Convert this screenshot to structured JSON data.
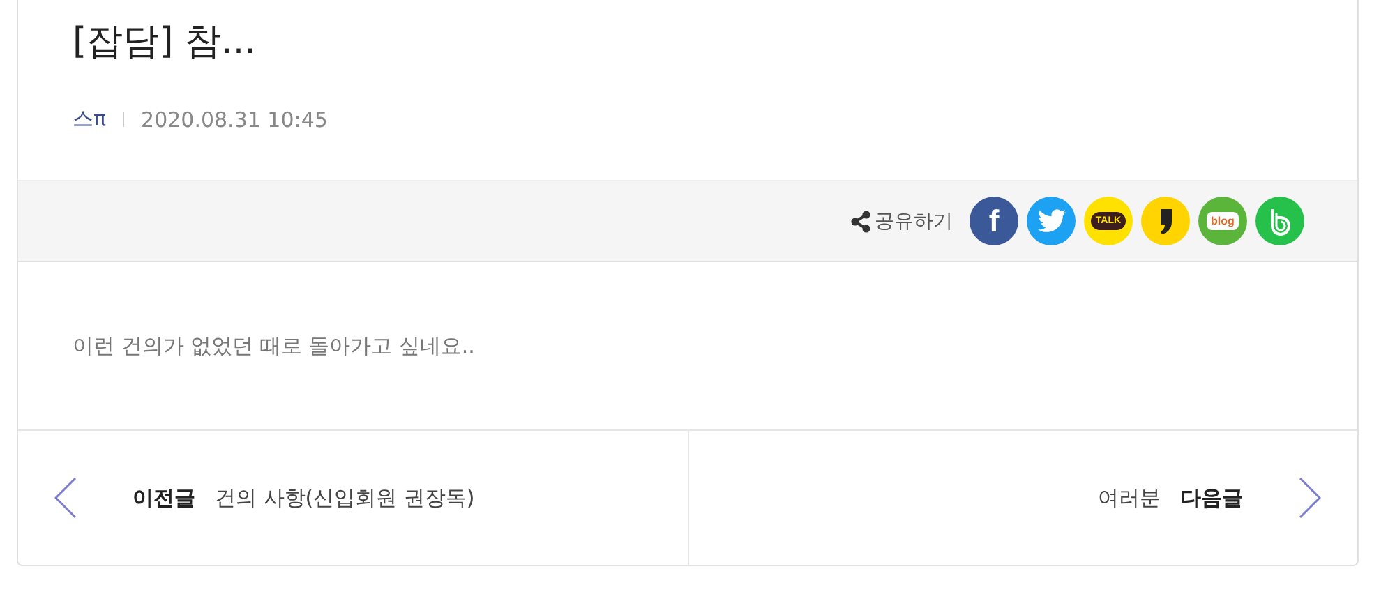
{
  "post": {
    "title": "[잡담] 참...",
    "author": "스π",
    "date": "2020.08.31 10:45"
  },
  "share": {
    "label": "공유하기",
    "buttons": [
      {
        "kind": "f",
        "label": "f"
      },
      {
        "kind": "bird"
      },
      {
        "kind": "talk",
        "label": "TALK"
      },
      {
        "kind": "comma"
      },
      {
        "kind": "blog",
        "label": "blog"
      },
      {
        "kind": "b"
      }
    ]
  },
  "body": "이런 건의가 없었던 때로 돌아가고 싶네요..",
  "nav": {
    "prev": {
      "label": "이전글",
      "title": "건의 사항(신입회원 권장독)"
    },
    "next": {
      "label": "다음글",
      "title": "여러분"
    }
  }
}
